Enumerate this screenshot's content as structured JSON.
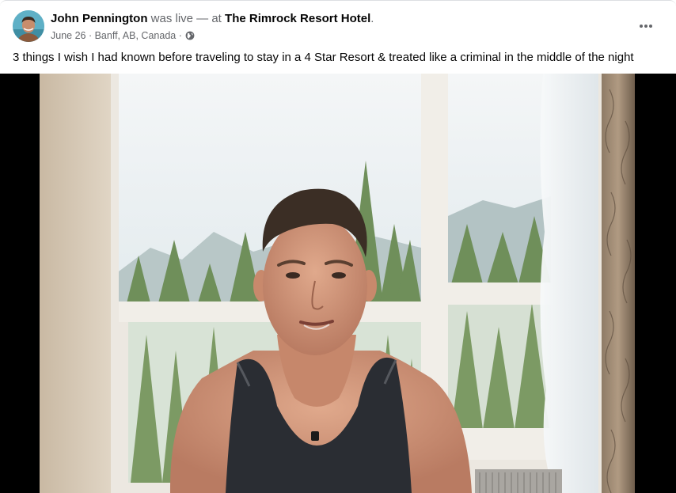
{
  "post": {
    "author_name": "John Pennington",
    "live_text": "was live — at",
    "location_name": "The Rimrock Resort Hotel",
    "location_suffix": ".",
    "date": "June 26",
    "separator_1": " · ",
    "place": "Banff, AB, Canada",
    "separator_2": " ·",
    "privacy_icon": "globe-icon",
    "caption": "3 things I wish I had known before traveling to stay in a 4 Star Resort & treated like a criminal in the middle of the night",
    "more_icon": "more-horizontal-icon"
  },
  "colors": {
    "primary_text": "#050505",
    "secondary_text": "#65676b",
    "video_background": "#000000"
  }
}
